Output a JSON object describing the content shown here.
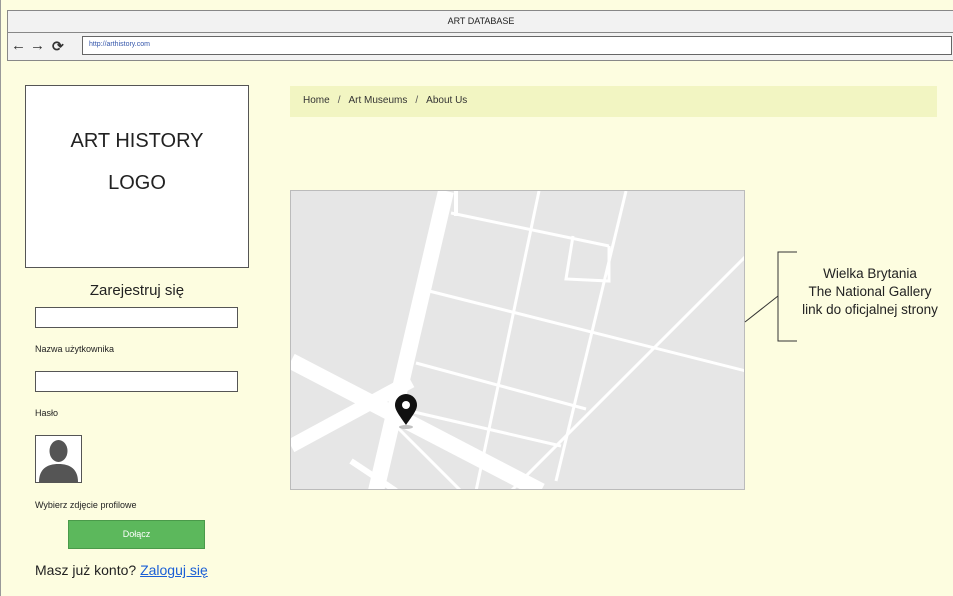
{
  "window": {
    "title": "ART DATABASE",
    "url": "http://arthistory.com",
    "nav": {
      "back": "←",
      "forward": "→",
      "reload": "⟳"
    }
  },
  "logo": {
    "line1": "ART HISTORY",
    "line2": "LOGO"
  },
  "register": {
    "title": "Zarejestruj się",
    "username_label": "Nazwa użytkownika",
    "username_value": "",
    "password_label": "Hasło",
    "password_value": "",
    "avatar_label": "Wybierz zdjęcie profilowe",
    "join_label": "Dołącz",
    "have_account": "Masz już konto? ",
    "login_link": "Zaloguj się "
  },
  "breadcrumb": {
    "items": [
      "Home",
      "Art Museums",
      "About Us"
    ],
    "separator": "/"
  },
  "map": {
    "marker_icon": "map-pin-icon"
  },
  "callout": {
    "country": "Wielka Brytania",
    "museum": "The National Gallery",
    "link": "link do oficjalnej strony"
  },
  "colors": {
    "page_background": "#fdfde0",
    "breadcrumb_background": "#f2f5c2",
    "join_button": "#5cb85c",
    "link": "#1a5fd6"
  }
}
